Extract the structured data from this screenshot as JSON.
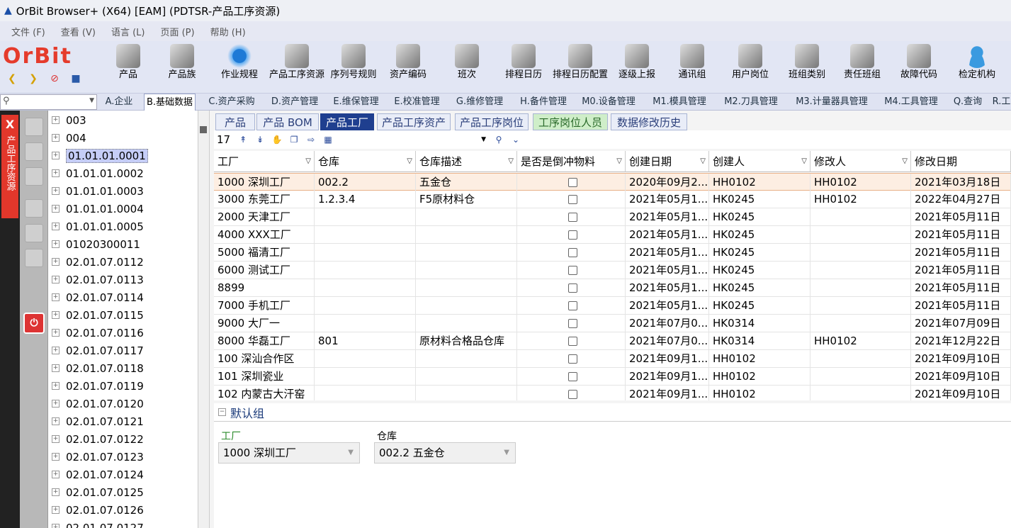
{
  "window": {
    "title": "OrBit Browser+ (X64) [EAM] (PDTSR-产品工序资源)"
  },
  "menu": [
    "文件 (F)",
    "查看 (V)",
    "语言 (L)",
    "页面 (P)",
    "帮助 (H)"
  ],
  "logo": "OrBit",
  "toolbar": [
    {
      "label": "产品",
      "icon": "product-icon"
    },
    {
      "label": "产品族",
      "icon": "product-family-icon"
    },
    {
      "label": "作业规程",
      "icon": "gear-icon"
    },
    {
      "label": "产品工序资源",
      "icon": "module-icon"
    },
    {
      "label": "序列号规则",
      "icon": "module-icon"
    },
    {
      "label": "资产编码",
      "icon": "module-icon"
    },
    {
      "label": "班次",
      "icon": "clock-icon"
    },
    {
      "label": "排程日历",
      "icon": "module-icon"
    },
    {
      "label": "排程日历配置",
      "icon": "module-icon"
    },
    {
      "label": "逐级上报",
      "icon": "module-icon"
    },
    {
      "label": "通讯组",
      "icon": "module-icon"
    },
    {
      "label": "用户岗位",
      "icon": "module-icon"
    },
    {
      "label": "班组类别",
      "icon": "module-icon"
    },
    {
      "label": "责任班组",
      "icon": "module-icon"
    },
    {
      "label": "故障代码",
      "icon": "module-icon"
    },
    {
      "label": "检定机构",
      "icon": "person-icon"
    }
  ],
  "module_tabs": [
    "A.企业",
    "B.基础数据",
    "C.资产采购",
    "D.资产管理",
    "E.维保管理",
    "E.校准管理",
    "G.维修管理",
    "H.备件管理",
    "M0.设备管理",
    "M1.模具管理",
    "M2.刀具管理",
    "M3.计量器具管理",
    "M4.工具管理",
    "Q.查询",
    "R.工"
  ],
  "active_module": "B.基础数据",
  "left_panel": {
    "title": "产品工序资源",
    "close": "X"
  },
  "tree": [
    "003",
    "004",
    "01.01.01.0001",
    "01.01.01.0002",
    "01.01.01.0003",
    "01.01.01.0004",
    "01.01.01.0005",
    "01020300011",
    "02.01.07.0112",
    "02.01.07.0113",
    "02.01.07.0114",
    "02.01.07.0115",
    "02.01.07.0116",
    "02.01.07.0117",
    "02.01.07.0118",
    "02.01.07.0119",
    "02.01.07.0120",
    "02.01.07.0121",
    "02.01.07.0122",
    "02.01.07.0123",
    "02.01.07.0124",
    "02.01.07.0125",
    "02.01.07.0126",
    "02.01.07.0127"
  ],
  "tree_selected": "01.01.01.0001",
  "sub_tabs": [
    "产品",
    "产品 BOM",
    "产品工厂",
    "产品工序资产",
    "产品工序岗位",
    "工序岗位人员",
    "数据修改历史"
  ],
  "active_sub_tab": "产品工厂",
  "record_count": "17",
  "columns": [
    "工厂",
    "仓库",
    "仓库描述",
    "是否是倒冲物料",
    "创建日期",
    "创建人",
    "修改人",
    "修改日期"
  ],
  "rows": [
    [
      "1000 深圳工厂",
      "002.2",
      "五金仓",
      "",
      "2020年09月2...",
      "HH0102",
      "HH0102",
      "2021年03月18日"
    ],
    [
      "3000 东莞工厂",
      "1.2.3.4",
      "F5原材料仓",
      "",
      "2021年05月1...",
      "HK0245",
      "HH0102",
      "2022年04月27日"
    ],
    [
      "2000 天津工厂",
      "",
      "",
      "",
      "2021年05月1...",
      "HK0245",
      "",
      "2021年05月11日"
    ],
    [
      "4000 XXX工厂",
      "",
      "",
      "",
      "2021年05月1...",
      "HK0245",
      "",
      "2021年05月11日"
    ],
    [
      "5000 福清工厂",
      "",
      "",
      "",
      "2021年05月1...",
      "HK0245",
      "",
      "2021年05月11日"
    ],
    [
      "6000 测试工厂",
      "",
      "",
      "",
      "2021年05月1...",
      "HK0245",
      "",
      "2021年05月11日"
    ],
    [
      "8899",
      "",
      "",
      "",
      "2021年05月1...",
      "HK0245",
      "",
      "2021年05月11日"
    ],
    [
      "7000 手机工厂",
      "",
      "",
      "",
      "2021年05月1...",
      "HK0245",
      "",
      "2021年05月11日"
    ],
    [
      "9000 大厂一",
      "",
      "",
      "",
      "2021年07月0...",
      "HK0314",
      "",
      "2021年07月09日"
    ],
    [
      "8000 华磊工厂",
      "801",
      "原材料合格品仓库",
      "",
      "2021年07月0...",
      "HK0314",
      "HH0102",
      "2021年12月22日"
    ],
    [
      "100 深汕合作区",
      "",
      "",
      "",
      "2021年09月1...",
      "HH0102",
      "",
      "2021年09月10日"
    ],
    [
      "101 深圳瓷业",
      "",
      "",
      "",
      "2021年09月1...",
      "HH0102",
      "",
      "2021年09月10日"
    ],
    [
      "102 内蒙古大汗窑",
      "",
      "",
      "",
      "2021年09月1...",
      "HH0102",
      "",
      "2021年09月10日"
    ]
  ],
  "form": {
    "group": "默认组",
    "factory_label": "工厂",
    "factory_value": "1000 深圳工厂",
    "warehouse_label": "仓库",
    "warehouse_value": "002.2 五金仓"
  },
  "colors": {
    "accent": "#1f3f8f",
    "logo": "#e53b2c",
    "selected_row": "#fdeee2",
    "close_strip": "#e2372b"
  }
}
